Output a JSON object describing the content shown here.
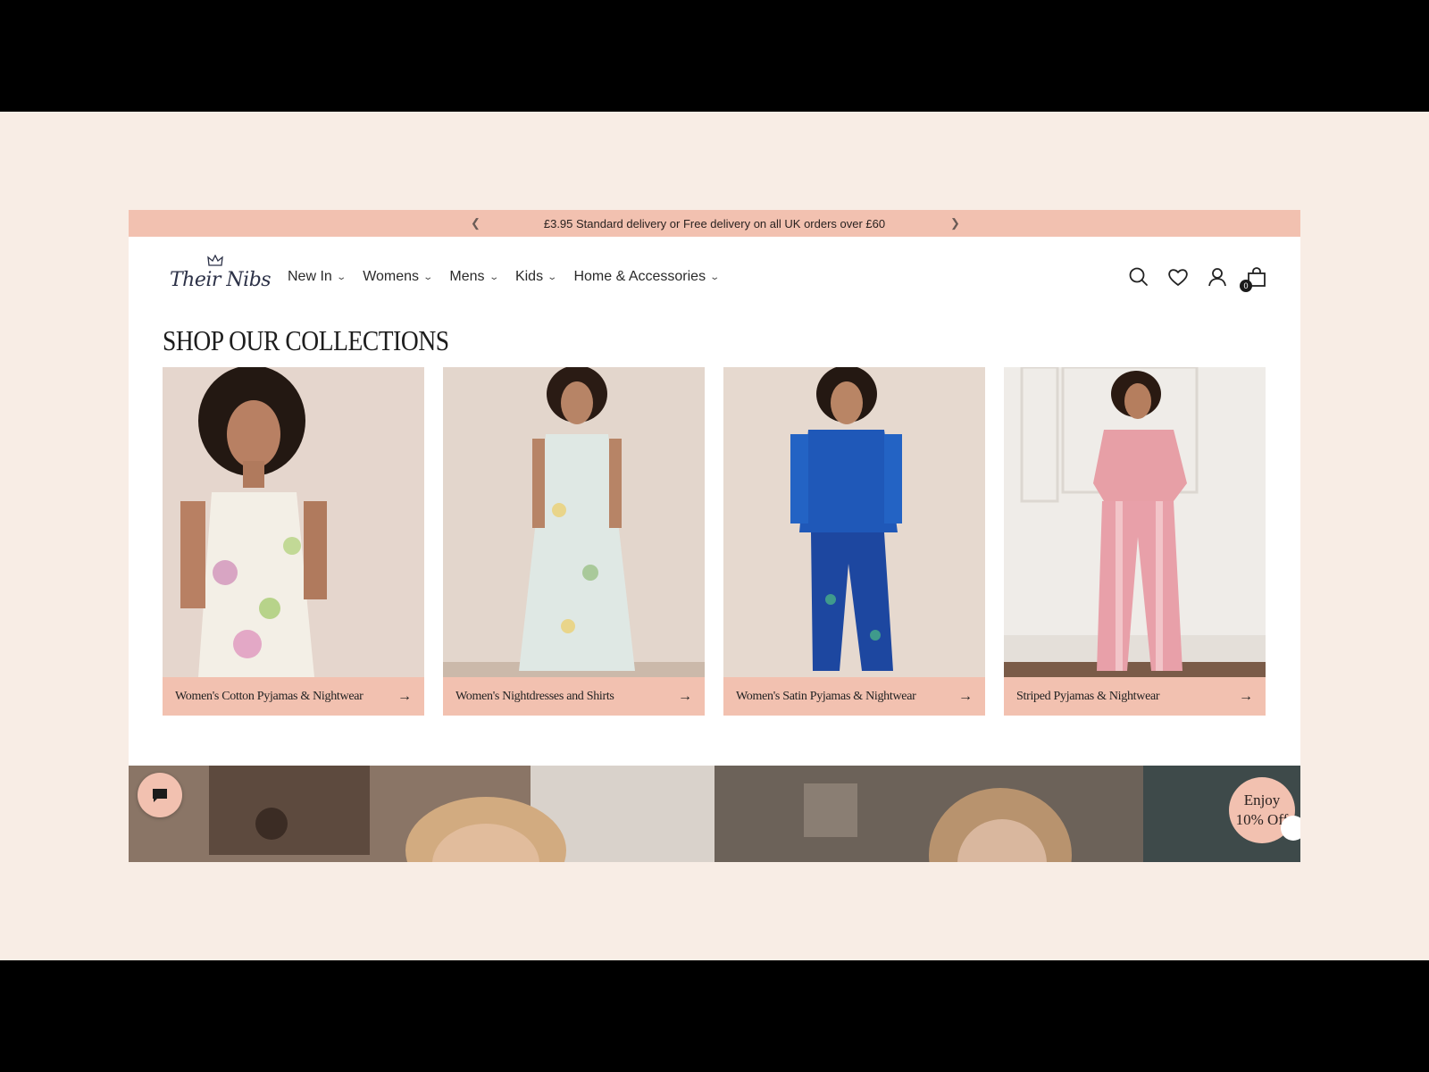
{
  "announcement": {
    "text": "£3.95 Standard delivery or Free delivery on all UK orders over £60",
    "prev_icon": "chevron-left-icon",
    "next_icon": "chevron-right-icon"
  },
  "brand": {
    "logo_text": "Their Nibs"
  },
  "nav": {
    "items": [
      {
        "label": "New In"
      },
      {
        "label": "Womens"
      },
      {
        "label": "Mens"
      },
      {
        "label": "Kids"
      },
      {
        "label": "Home & Accessories"
      }
    ]
  },
  "header_icons": {
    "search": "search-icon",
    "wishlist": "heart-icon",
    "account": "user-icon",
    "cart": "shopping-bag-icon",
    "cart_count": "0"
  },
  "section": {
    "title": "SHOP OUR COLLECTIONS",
    "collections": [
      {
        "label": "Women's Cotton Pyjamas & Nightwear"
      },
      {
        "label": "Women's Nightdresses and Shirts"
      },
      {
        "label": "Women's Satin Pyjamas & Nightwear"
      },
      {
        "label": "Striped Pyjamas & Nightwear"
      }
    ]
  },
  "offer": {
    "line1": "Enjoy",
    "line2": "10% Off"
  },
  "colors": {
    "accent": "#f2c1b0",
    "page_bg": "#f8ede5",
    "text": "#222222"
  }
}
